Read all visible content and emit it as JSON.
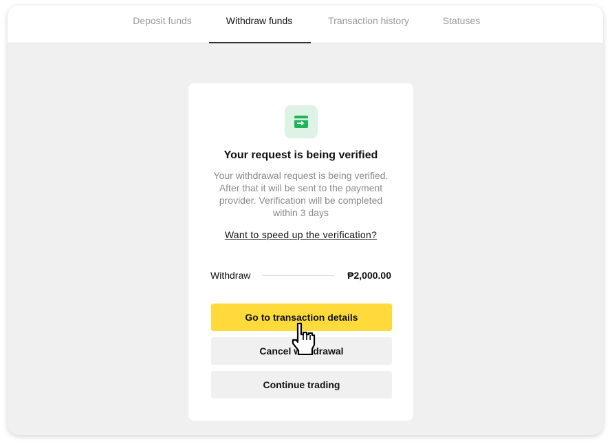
{
  "tabs": [
    {
      "label": "Deposit funds",
      "active": false
    },
    {
      "label": "Withdraw funds",
      "active": true
    },
    {
      "label": "Transaction history",
      "active": false
    },
    {
      "label": "Statuses",
      "active": false
    }
  ],
  "card": {
    "icon": "card-transfer-icon",
    "title": "Your request is being verified",
    "description_lines": [
      "Your withdrawal request is being verified.",
      "After that it will be sent to the payment",
      "provider. Verification will be completed",
      "within 3 days"
    ],
    "speed_link": "Want to speed up the verification?",
    "withdraw_label": "Withdraw",
    "withdraw_amount": "₱2,000.00",
    "buttons": {
      "primary": "Go to transaction details",
      "cancel": "Cancel withdrawal",
      "continue": "Continue trading"
    }
  },
  "colors": {
    "accent_yellow": "#fedb3a",
    "icon_green": "#1fb35a",
    "icon_bg": "#dff2e6",
    "page_bg": "#f0f0f0"
  },
  "cursor": "hand-pointer-icon"
}
